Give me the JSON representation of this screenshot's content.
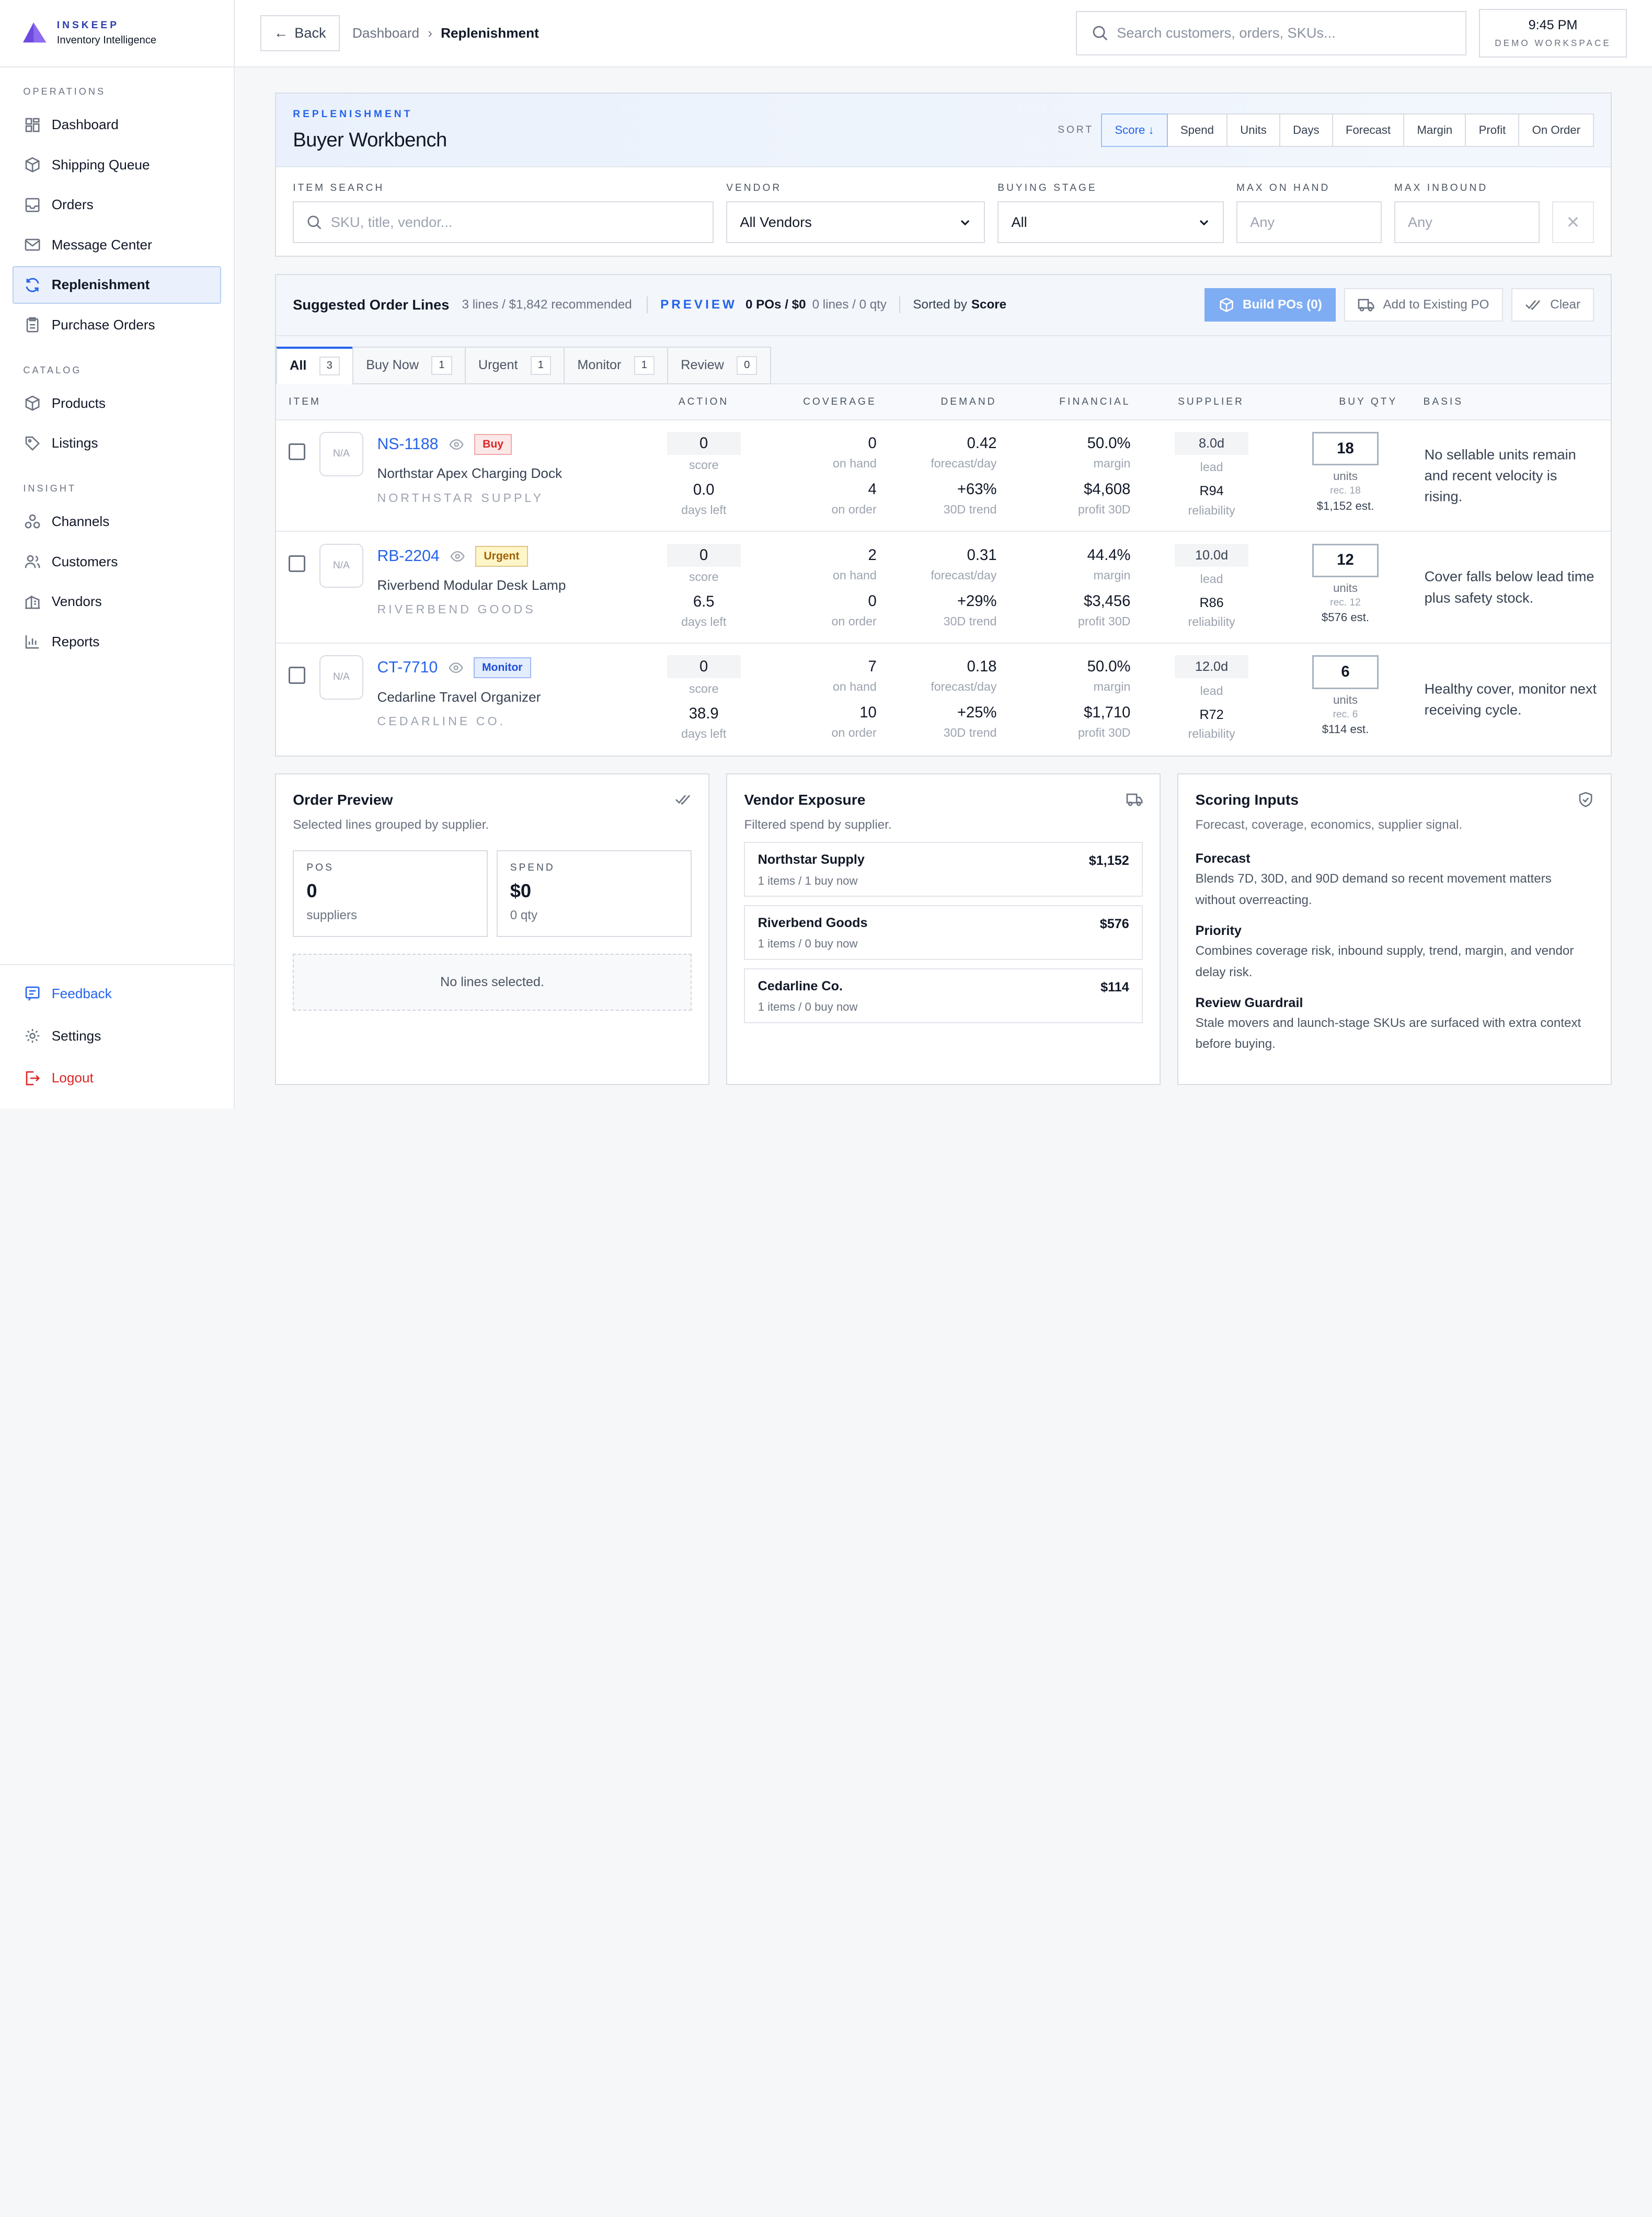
{
  "brand": {
    "kicker": "INSKEEP",
    "name": "Inventory Intelligence"
  },
  "sidebar": {
    "sections": [
      "OPERATIONS",
      "CATALOG",
      "INSIGHT"
    ],
    "items": [
      {
        "label": "Dashboard",
        "icon": "dashboard-icon"
      },
      {
        "label": "Shipping Queue",
        "icon": "box-icon"
      },
      {
        "label": "Orders",
        "icon": "inbox-icon"
      },
      {
        "label": "Message Center",
        "icon": "mail-icon"
      },
      {
        "label": "Replenishment",
        "icon": "refresh-icon",
        "active": true
      },
      {
        "label": "Purchase Orders",
        "icon": "clipboard-icon"
      },
      {
        "label": "Products",
        "icon": "cube-icon"
      },
      {
        "label": "Listings",
        "icon": "tag-icon"
      },
      {
        "label": "Channels",
        "icon": "channels-icon"
      },
      {
        "label": "Customers",
        "icon": "users-icon"
      },
      {
        "label": "Vendors",
        "icon": "building-icon"
      },
      {
        "label": "Reports",
        "icon": "bar-chart-icon"
      }
    ],
    "bottom": [
      {
        "label": "Feedback",
        "icon": "feedback-icon",
        "color": "#2563eb"
      },
      {
        "label": "Settings",
        "icon": "gear-icon",
        "color": "#111827"
      },
      {
        "label": "Logout",
        "icon": "logout-icon",
        "color": "#dc2626"
      }
    ]
  },
  "topbar": {
    "back_label": "Back",
    "breadcrumb": [
      "Dashboard",
      "Replenishment"
    ],
    "search_placeholder": "Search customers, orders, SKUs...",
    "time": "9:45 PM",
    "workspace": "DEMO WORKSPACE"
  },
  "workbench": {
    "kicker": "REPLENISHMENT",
    "title": "Buyer Workbench",
    "sort_label": "SORT",
    "sort_options": [
      "Score ↓",
      "Spend",
      "Units",
      "Days",
      "Forecast",
      "Margin",
      "Profit",
      "On Order"
    ],
    "filters": {
      "item_search": {
        "label": "ITEM SEARCH",
        "placeholder": "SKU, title, vendor..."
      },
      "vendor": {
        "label": "VENDOR",
        "value": "All Vendors"
      },
      "buying_stage": {
        "label": "BUYING STAGE",
        "value": "All"
      },
      "max_on_hand": {
        "label": "MAX ON HAND",
        "placeholder": "Any"
      },
      "max_inbound": {
        "label": "MAX INBOUND",
        "placeholder": "Any"
      }
    }
  },
  "suggested": {
    "title": "Suggested Order Lines",
    "summary": "3 lines / $1,842 recommended",
    "preview_label": "PREVIEW",
    "preview_value": "0 POs / $0",
    "preview_detail": "0 lines / 0 qty",
    "sorted_by_prefix": "Sorted by",
    "sorted_by": "Score",
    "actions": {
      "build": "Build POs (0)",
      "add_existing": "Add to Existing PO",
      "clear": "Clear"
    },
    "tabs": [
      {
        "label": "All",
        "count": "3"
      },
      {
        "label": "Buy Now",
        "count": "1"
      },
      {
        "label": "Urgent",
        "count": "1"
      },
      {
        "label": "Monitor",
        "count": "1"
      },
      {
        "label": "Review",
        "count": "0"
      }
    ],
    "columns": [
      "ITEM",
      "ACTION",
      "COVERAGE",
      "DEMAND",
      "FINANCIAL",
      "SUPPLIER",
      "BUY QTY",
      "BASIS"
    ],
    "rows": [
      {
        "thumb": "N/A",
        "sku": "NS-1188",
        "badge": "Buy",
        "badge_color": "#dc2626",
        "badge_bg": "#fde8e8",
        "name": "Northstar Apex Charging Dock",
        "vendor": "NORTHSTAR SUPPLY",
        "score": "0",
        "score_label": "score",
        "days": "0.0",
        "days_label": "days left",
        "on_hand": "0",
        "on_hand_label": "on hand",
        "on_order": "4",
        "on_order_label": "on order",
        "forecast": "0.42",
        "forecast_label": "forecast/day",
        "trend": "+63%",
        "trend_label": "30D trend",
        "margin": "50.0%",
        "margin_label": "margin",
        "profit": "$4,608",
        "profit_label": "profit 30D",
        "lead": "8.0d",
        "lead_label": "lead",
        "reliability": "R94",
        "reliability_label": "reliability",
        "qty": "18",
        "qty_label": "units",
        "rec": "rec. 18",
        "est": "$1,152 est.",
        "basis": "No sellable units remain and recent velocity is rising."
      },
      {
        "thumb": "N/A",
        "sku": "RB-2204",
        "badge": "Urgent",
        "badge_color": "#a16207",
        "badge_bg": "#fef6c8",
        "name": "Riverbend Modular Desk Lamp",
        "vendor": "RIVERBEND GOODS",
        "score": "0",
        "score_label": "score",
        "days": "6.5",
        "days_label": "days left",
        "on_hand": "2",
        "on_hand_label": "on hand",
        "on_order": "0",
        "on_order_label": "on order",
        "forecast": "0.31",
        "forecast_label": "forecast/day",
        "trend": "+29%",
        "trend_label": "30D trend",
        "margin": "44.4%",
        "margin_label": "margin",
        "profit": "$3,456",
        "profit_label": "profit 30D",
        "lead": "10.0d",
        "lead_label": "lead",
        "reliability": "R86",
        "reliability_label": "reliability",
        "qty": "12",
        "qty_label": "units",
        "rec": "rec. 12",
        "est": "$576 est.",
        "basis": "Cover falls below lead time plus safety stock."
      },
      {
        "thumb": "N/A",
        "sku": "CT-7710",
        "badge": "Monitor",
        "badge_color": "#1d4ed8",
        "badge_bg": "#e3edfd",
        "name": "Cedarline Travel Organizer",
        "vendor": "CEDARLINE CO.",
        "score": "0",
        "score_label": "score",
        "days": "38.9",
        "days_label": "days left",
        "on_hand": "7",
        "on_hand_label": "on hand",
        "on_order": "10",
        "on_order_label": "on order",
        "forecast": "0.18",
        "forecast_label": "forecast/day",
        "trend": "+25%",
        "trend_label": "30D trend",
        "margin": "50.0%",
        "margin_label": "margin",
        "profit": "$1,710",
        "profit_label": "profit 30D",
        "lead": "12.0d",
        "lead_label": "lead",
        "reliability": "R72",
        "reliability_label": "reliability",
        "qty": "6",
        "qty_label": "units",
        "rec": "rec. 6",
        "est": "$114 est.",
        "basis": "Healthy cover, monitor next receiving cycle."
      }
    ]
  },
  "order_preview": {
    "title": "Order Preview",
    "subtitle": "Selected lines grouped by supplier.",
    "pos": {
      "label": "POS",
      "value": "0",
      "sub": "suppliers"
    },
    "spend": {
      "label": "SPEND",
      "value": "$0",
      "sub": "0 qty"
    },
    "empty": "No lines selected."
  },
  "vendor_exposure": {
    "title": "Vendor Exposure",
    "subtitle": "Filtered spend by supplier.",
    "vendors": [
      {
        "name": "Northstar Supply",
        "counts": "1 items / 1 buy now",
        "amount": "$1,152"
      },
      {
        "name": "Riverbend Goods",
        "counts": "1 items / 0 buy now",
        "amount": "$576"
      },
      {
        "name": "Cedarline Co.",
        "counts": "1 items / 0 buy now",
        "amount": "$114"
      }
    ]
  },
  "scoring_inputs": {
    "title": "Scoring Inputs",
    "subtitle": "Forecast, coverage, economics, supplier signal.",
    "items": [
      {
        "heading": "Forecast",
        "body": "Blends 7D, 30D, and 90D demand so recent movement matters without overreacting."
      },
      {
        "heading": "Priority",
        "body": "Combines coverage risk, inbound supply, trend, margin, and vendor delay risk."
      },
      {
        "heading": "Review Guardrail",
        "body": "Stale movers and launch-stage SKUs are surfaced with extra context before buying."
      }
    ]
  }
}
